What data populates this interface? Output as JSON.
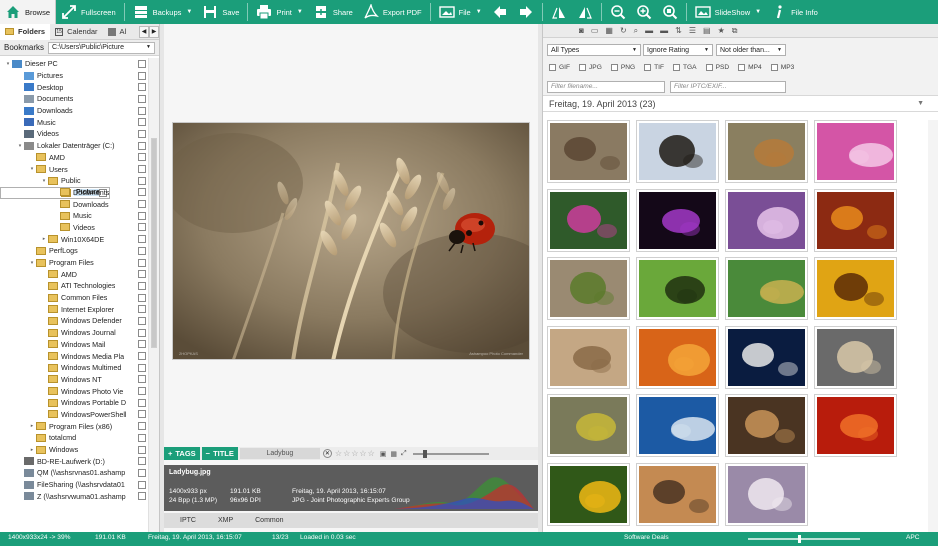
{
  "toolbar": {
    "items": [
      {
        "label": "Browse",
        "icon": "home-icon"
      },
      {
        "label": "Fullscreen",
        "icon": "fullscreen-icon"
      },
      {
        "label": "Backups",
        "icon": "backups-icon",
        "dropdown": true
      },
      {
        "label": "Save",
        "icon": "save-icon"
      },
      {
        "label": "Print",
        "icon": "print-icon",
        "dropdown": true
      },
      {
        "label": "Share",
        "icon": "share-icon"
      },
      {
        "label": "Export PDF",
        "icon": "export-pdf-icon"
      },
      {
        "label": "File",
        "icon": "file-icon",
        "dropdown": true
      },
      {
        "label": "SlideShow",
        "icon": "slideshow-icon",
        "dropdown": true
      },
      {
        "label": "File Info",
        "icon": "info-icon"
      }
    ],
    "accent": "#1b9e7a"
  },
  "left": {
    "tabs": [
      "Folders",
      "Calendar",
      "Al"
    ],
    "bookmarks_label": "Bookmarks",
    "path": "C:\\Users\\Public\\Picture",
    "tree": [
      {
        "label": "Dieser PC",
        "level": 0,
        "type": "pc",
        "expand": "▾"
      },
      {
        "label": "Pictures",
        "level": 1,
        "type": "pictures"
      },
      {
        "label": "Desktop",
        "level": 1,
        "type": "desktop"
      },
      {
        "label": "Documents",
        "level": 1,
        "type": "doc"
      },
      {
        "label": "Downloads",
        "level": 1,
        "type": "download"
      },
      {
        "label": "Music",
        "level": 1,
        "type": "music"
      },
      {
        "label": "Videos",
        "level": 1,
        "type": "video"
      },
      {
        "label": "Lokaler Datenträger (C:)",
        "level": 1,
        "type": "drive",
        "expand": "▾"
      },
      {
        "label": "AMD",
        "level": 2,
        "type": "folder"
      },
      {
        "label": "Users",
        "level": 2,
        "type": "folder",
        "expand": "▾"
      },
      {
        "label": "Public",
        "level": 3,
        "type": "folder",
        "expand": "▾"
      },
      {
        "label": "Pictures",
        "level": 4,
        "type": "folder",
        "selected": true
      },
      {
        "label": "Documents",
        "level": 4,
        "type": "folder"
      },
      {
        "label": "Downloads",
        "level": 4,
        "type": "folder"
      },
      {
        "label": "Music",
        "level": 4,
        "type": "folder"
      },
      {
        "label": "Videos",
        "level": 4,
        "type": "folder"
      },
      {
        "label": "Win10X64DE",
        "level": 3,
        "type": "folder",
        "expand": "▸"
      },
      {
        "label": "PerfLogs",
        "level": 2,
        "type": "folder"
      },
      {
        "label": "Program Files",
        "level": 2,
        "type": "folder",
        "expand": "▾"
      },
      {
        "label": "AMD",
        "level": 3,
        "type": "folder"
      },
      {
        "label": "ATI Technologies",
        "level": 3,
        "type": "folder"
      },
      {
        "label": "Common Files",
        "level": 3,
        "type": "folder"
      },
      {
        "label": "Internet Explorer",
        "level": 3,
        "type": "folder"
      },
      {
        "label": "Windows Defender",
        "level": 3,
        "type": "folder"
      },
      {
        "label": "Windows Journal",
        "level": 3,
        "type": "folder"
      },
      {
        "label": "Windows Mail",
        "level": 3,
        "type": "folder"
      },
      {
        "label": "Windows Media Pla",
        "level": 3,
        "type": "folder"
      },
      {
        "label": "Windows Multimed",
        "level": 3,
        "type": "folder"
      },
      {
        "label": "Windows NT",
        "level": 3,
        "type": "folder"
      },
      {
        "label": "Windows Photo Vie",
        "level": 3,
        "type": "folder"
      },
      {
        "label": "Windows Portable D",
        "level": 3,
        "type": "folder"
      },
      {
        "label": "WindowsPowerShell",
        "level": 3,
        "type": "folder"
      },
      {
        "label": "Program Files (x86)",
        "level": 2,
        "type": "folder",
        "expand": "▸"
      },
      {
        "label": "totalcmd",
        "level": 2,
        "type": "folder"
      },
      {
        "label": "Windows",
        "level": 2,
        "type": "folder",
        "expand": "▸"
      },
      {
        "label": "BD-RE-Laufwerk (D:)",
        "level": 1,
        "type": "optical"
      },
      {
        "label": "QM (\\\\ashsrvnas01.ashamp",
        "level": 1,
        "type": "net"
      },
      {
        "label": "FileSharing (\\\\ashsrvdata01",
        "level": 1,
        "type": "net"
      },
      {
        "label": "Z (\\\\ashsrvwuma01.ashamp",
        "level": 1,
        "type": "net"
      }
    ]
  },
  "preview": {
    "watermark_left": "2HOPKAS",
    "watermark_right": "Ashampoo Photo Commander",
    "tags_label": "TAGS",
    "title_label": "TITLE",
    "tag_value": "Ladybug",
    "rating": 0,
    "info": {
      "filename": "Ladybug.jpg",
      "dims": "1400x933 px",
      "bpp": "24 Bpp (1.3 MP)",
      "size": "191.01 KB",
      "dpi": "96x96 DPI",
      "date": "Freitag, 19. April 2013, 16:15:07",
      "format": "JPG - Joint Photographic Experts Group"
    },
    "meta_tabs": [
      "IPTC",
      "XMP",
      "Common"
    ]
  },
  "right": {
    "filters": {
      "type": "All Types",
      "rating": "Ignore Rating",
      "age": "Not older than...",
      "formats": [
        "GIF",
        "JPG",
        "PNG",
        "TIF",
        "TGA",
        "PSD",
        "MP4",
        "MP3"
      ],
      "filename_placeholder": "Filter filename...",
      "iptc_placeholder": "Filter IPTC/EXIF..."
    },
    "group_title": "Freitag, 19. April 2013 (23)",
    "thumbnails": [
      {
        "name": "lizard",
        "bg": "#8a7a62",
        "fg": "#5a4634"
      },
      {
        "name": "butterfly",
        "bg": "#c9d4e2",
        "fg": "#1f1a14"
      },
      {
        "name": "sparrow",
        "bg": "#8a7f60",
        "fg": "#b57a3a"
      },
      {
        "name": "pink-flowers",
        "bg": "#d455a6",
        "fg": "#f4c8e6"
      },
      {
        "name": "purple-flower",
        "bg": "#2f5a2a",
        "fg": "#cc3c9c"
      },
      {
        "name": "smoke",
        "bg": "#140818",
        "fg": "#a238c8"
      },
      {
        "name": "lilac-flowers",
        "bg": "#7a4e96",
        "fg": "#e6c3ea"
      },
      {
        "name": "peppers",
        "bg": "#8c2a12",
        "fg": "#e88a1c"
      },
      {
        "name": "grasshopper",
        "bg": "#9a8a72",
        "fg": "#5a7a2a"
      },
      {
        "name": "fly",
        "bg": "#6aa83a",
        "fg": "#203010"
      },
      {
        "name": "dragonfly",
        "bg": "#4a8a3a",
        "fg": "#c8b050"
      },
      {
        "name": "yellow-flower",
        "bg": "#e0a414",
        "fg": "#5a2c06"
      },
      {
        "name": "grass",
        "bg": "#c4a784",
        "fg": "#8a6a46"
      },
      {
        "name": "lily",
        "bg": "#d86418",
        "fg": "#f4a438"
      },
      {
        "name": "moon",
        "bg": "#0a1c40",
        "fg": "#e8e8e8"
      },
      {
        "name": "mushrooms",
        "bg": "#6a6a6a",
        "fg": "#d8c8a8"
      },
      {
        "name": "bird",
        "bg": "#7a7a5a",
        "fg": "#c8b838"
      },
      {
        "name": "blue-bird",
        "bg": "#1c5aa4",
        "fg": "#d8e4f0"
      },
      {
        "name": "dog",
        "bg": "#4a3422",
        "fg": "#c89458"
      },
      {
        "name": "red-flower",
        "bg": "#b81c0c",
        "fg": "#f07028"
      },
      {
        "name": "sunflower",
        "bg": "#305818",
        "fg": "#f0b814"
      },
      {
        "name": "sunset",
        "bg": "#c48a52",
        "fg": "#4a3222"
      },
      {
        "name": "windmills",
        "bg": "#9a8aa8",
        "fg": "#f0e8f0"
      }
    ]
  },
  "status": {
    "dims": "1400x933x24 -> 39%",
    "size": "191.01 KB",
    "date": "Freitag, 19. April 2013, 16:15:07",
    "count": "13/23",
    "loaded": "Loaded in 0.03 sec",
    "deals": "Software Deals",
    "apc": "APC"
  }
}
